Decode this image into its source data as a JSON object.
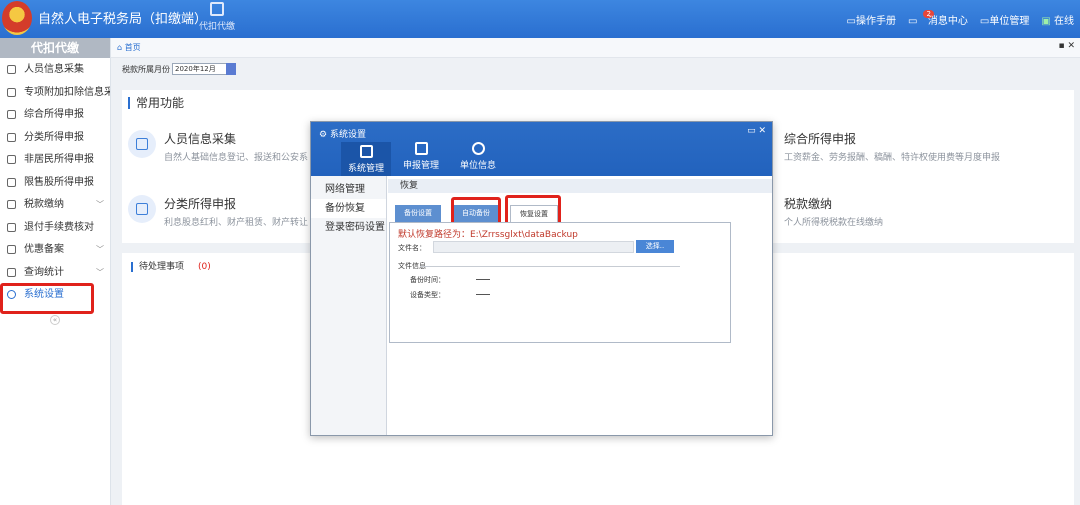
{
  "app": {
    "title": "自然人电子税务局（扣缴端）",
    "module_label": "代扣代缴",
    "links": {
      "manual": "操作手册",
      "messages": "消息中心",
      "unit": "单位管理",
      "status": "在线"
    },
    "message_count": "2"
  },
  "sidebar": {
    "header": "代扣代缴",
    "items": [
      {
        "label": "人员信息采集"
      },
      {
        "label": "专项附加扣除信息采"
      },
      {
        "label": "综合所得申报"
      },
      {
        "label": "分类所得申报"
      },
      {
        "label": "非居民所得申报"
      },
      {
        "label": "限售股所得申报"
      },
      {
        "label": "税款缴纳",
        "chevron": "﹀"
      },
      {
        "label": "退付手续费核对"
      },
      {
        "label": "优惠备案",
        "chevron": "﹀"
      },
      {
        "label": "查询统计",
        "chevron": "﹀"
      },
      {
        "label": "系统设置"
      }
    ],
    "collapse": "«"
  },
  "main": {
    "breadcrumb": "首页",
    "period_label": "税款所属月份",
    "period_value": "2020年12月",
    "common_title": "常用功能",
    "functions": [
      {
        "name": "人员信息采集",
        "desc": "自然人基础信息登记、报送和公安系"
      },
      {
        "name": "综合所得申报",
        "desc": "工资薪金、劳务报酬、稿酬、特许权使用费等月度申报"
      },
      {
        "name": "分类所得申报",
        "desc": "利息股息红利、财产租赁、财产转让"
      },
      {
        "name": "税款缴纳",
        "desc": "个人所得税税款在线缴纳"
      }
    ],
    "pending_title": "待处理事项",
    "pending_count": "(0)"
  },
  "dialog": {
    "title": "系统设置",
    "tabs": [
      {
        "label": "系统管理"
      },
      {
        "label": "申报管理"
      },
      {
        "label": "单位信息"
      }
    ],
    "nav": [
      {
        "label": "网络管理"
      },
      {
        "label": "备份恢复"
      },
      {
        "label": "登录密码设置"
      }
    ],
    "section": "恢复",
    "subtabs": [
      {
        "label": "备份设置"
      },
      {
        "label": "自动备份"
      },
      {
        "label": "恢复设置"
      }
    ],
    "default_path": "默认恢复路径为：E:\\Zrrssglxt\\dataBackup",
    "file_label": "文件名：",
    "choose_btn": "选择..",
    "file_info": "文件信息",
    "backup_time": "备份时间：",
    "device_type": "设备类型："
  }
}
